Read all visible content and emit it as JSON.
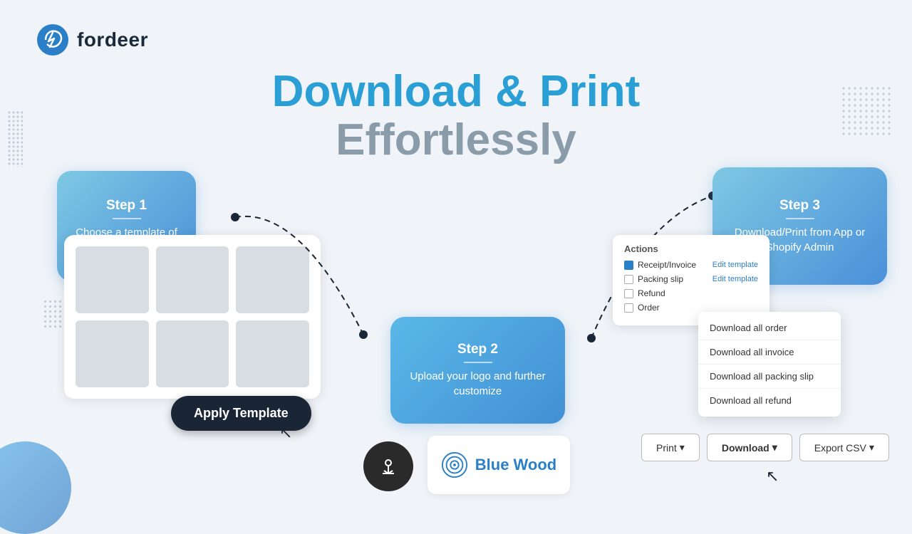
{
  "logo": {
    "text": "fordeer"
  },
  "title": {
    "line1": "Download & Print",
    "line2": "Effortlessly"
  },
  "step1": {
    "label": "Step 1",
    "desc": "Choose a template of document"
  },
  "step2": {
    "label": "Step 2",
    "desc": "Upload your logo and further customize"
  },
  "step3": {
    "label": "Step 3",
    "desc": "Download/Print from App or Shopify Admin"
  },
  "applyBtn": "Apply Template",
  "bluewood": {
    "text": "Blue Wood"
  },
  "actions": {
    "title": "Actions",
    "items": [
      {
        "label": "Receipt/Invoice",
        "checked": true,
        "editLink": "Edit template"
      },
      {
        "label": "Packing slip",
        "checked": false,
        "editLink": "Edit template"
      },
      {
        "label": "Refund",
        "checked": false
      },
      {
        "label": "Order",
        "checked": false
      }
    ]
  },
  "dropdown": {
    "items": [
      "Download all order",
      "Download all invoice",
      "Download all packing slip",
      "Download all refund"
    ]
  },
  "bottomBtns": [
    {
      "label": "Print"
    },
    {
      "label": "Download"
    },
    {
      "label": "Export CSV"
    }
  ]
}
